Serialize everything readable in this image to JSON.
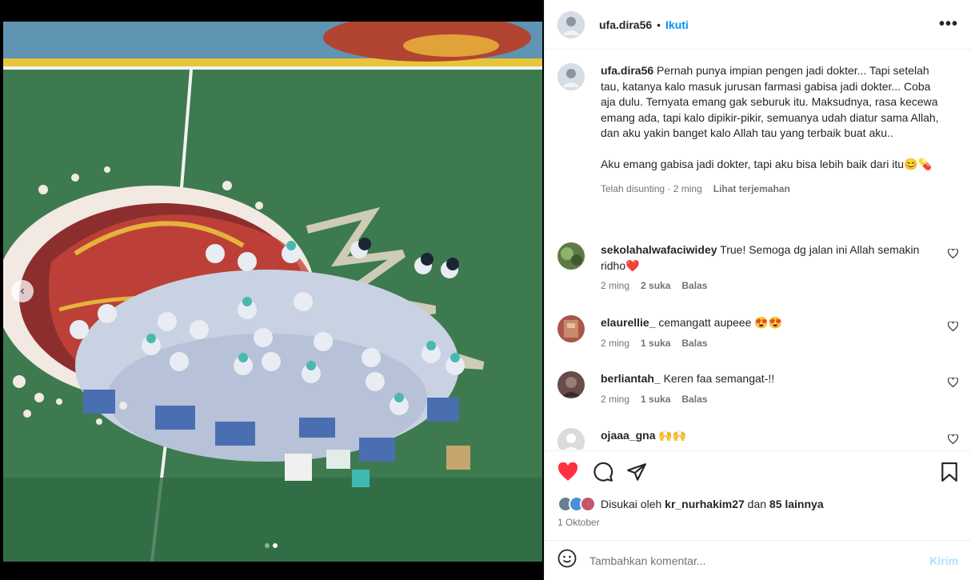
{
  "post": {
    "username": "ufa.dira56",
    "separator": "•",
    "follow_label": "Ikuti",
    "more_label": "•••"
  },
  "caption": {
    "username": "ufa.dira56",
    "paragraph1": "Pernah punya impian pengen jadi dokter... Tapi setelah tau, katanya kalo masuk jurusan farmasi gabisa jadi dokter... Coba aja dulu. Ternyata emang gak seburuk itu. Maksudnya, rasa kecewa emang ada, tapi kalo dipikir-pikir, semuanya udah diatur sama Allah, dan aku yakin banget kalo Allah tau yang terbaik buat aku..",
    "paragraph2": "Aku emang gabisa jadi dokter, tapi aku bisa lebih baik dari itu😊💊",
    "edited": "Telah disunting · 2 ming",
    "translate": "Lihat terjemahan"
  },
  "comments": [
    {
      "username": "sekolahalwafaciwidey",
      "text": "True! Semoga dg jalan ini Allah semakin ridho❤️",
      "time": "2 ming",
      "likes": "2 suka",
      "reply": "Balas"
    },
    {
      "username": "elaurellie_",
      "text": "cemangatt aupeee 😍😍",
      "time": "2 ming",
      "likes": "1 suka",
      "reply": "Balas"
    },
    {
      "username": "berliantah_",
      "text": "Keren faa semangat-!!",
      "time": "2 ming",
      "likes": "1 suka",
      "reply": "Balas"
    },
    {
      "username": "ojaaa_gna",
      "text": "🙌🙌",
      "time": "",
      "likes": "",
      "reply": ""
    }
  ],
  "likes": {
    "prefix": "Disukai oleh",
    "user": "kr_nurhakim27",
    "middle": "dan",
    "others": "85 lainnya"
  },
  "date": "1 Oktober",
  "add_comment": {
    "placeholder": "Tambahkan komentar...",
    "post_label": "Kirim"
  },
  "colors": {
    "accent": "#0095f6",
    "like_red": "#ff3040"
  },
  "media": {
    "current_slide": 2,
    "total_slides": 2,
    "prev_icon": "‹"
  }
}
